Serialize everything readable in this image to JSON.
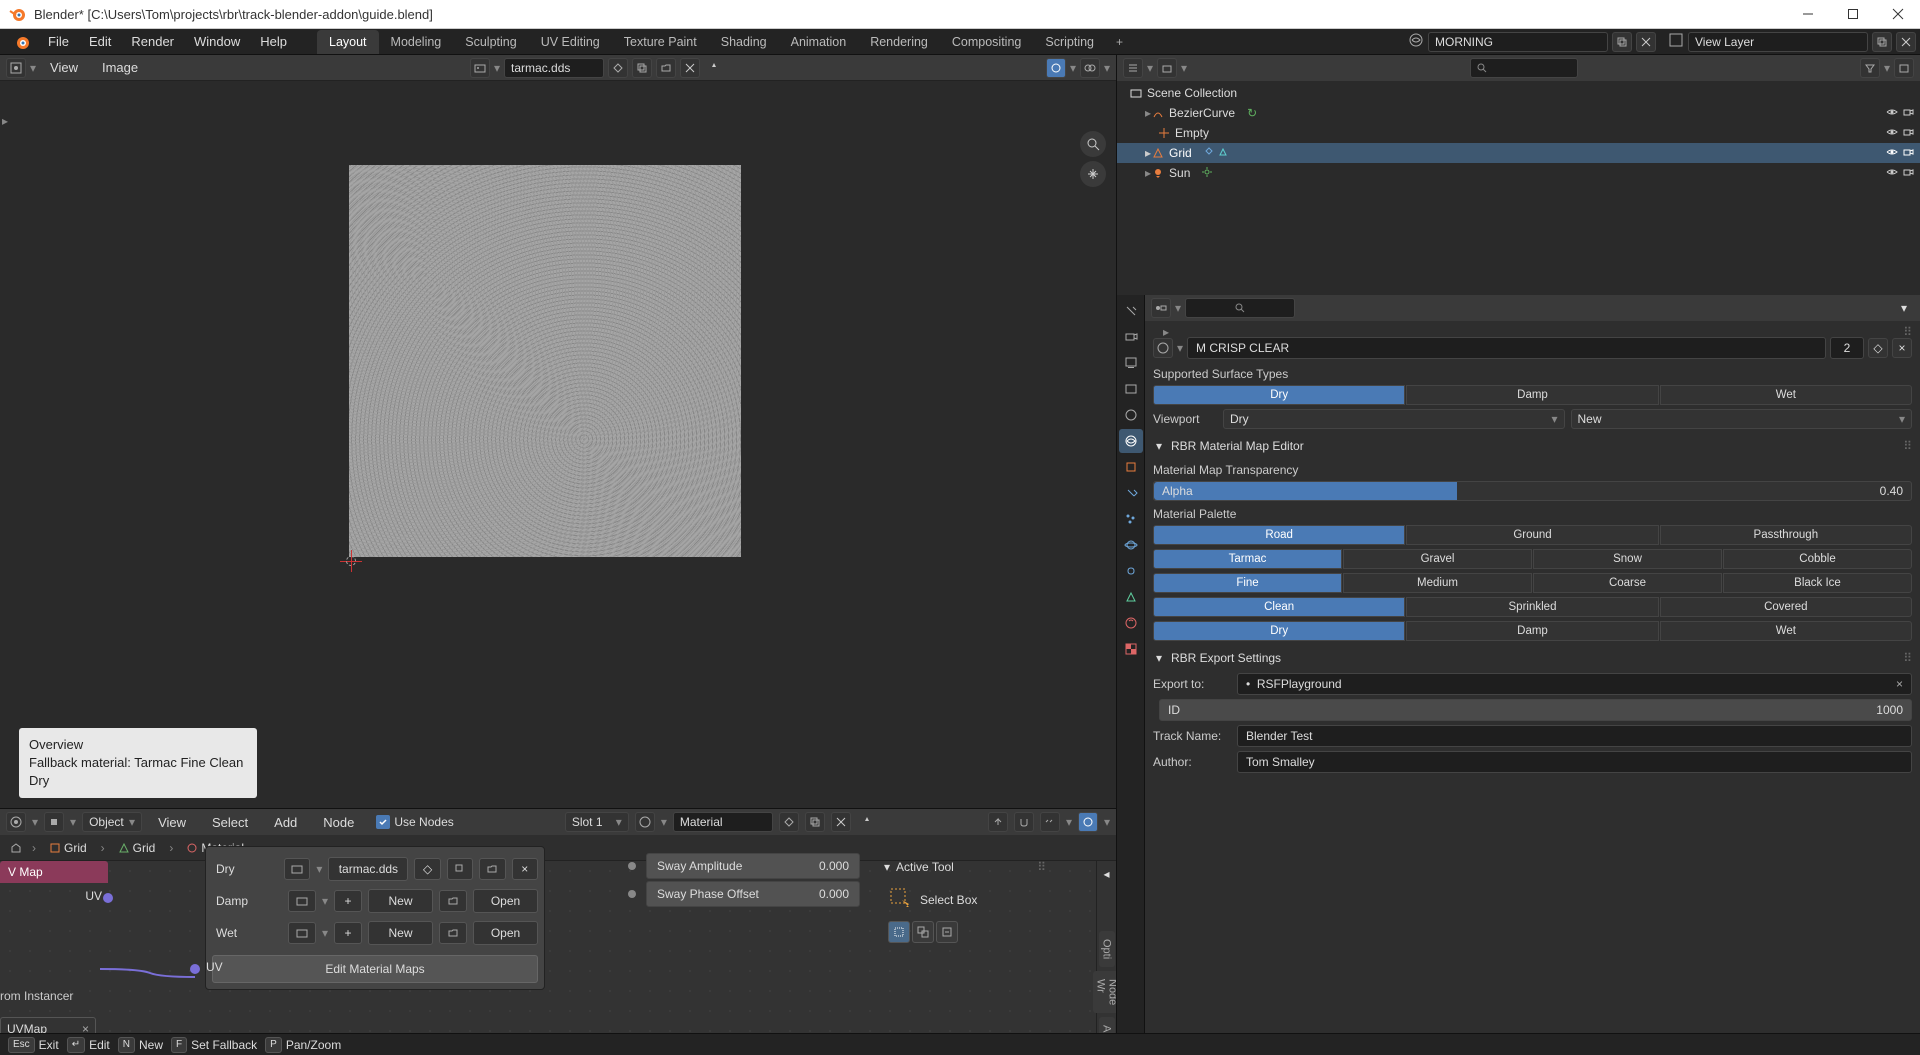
{
  "window": {
    "title": "Blender* [C:\\Users\\Tom\\projects\\rbr\\track-blender-addon\\guide.blend]"
  },
  "menubar": {
    "items": [
      "File",
      "Edit",
      "Render",
      "Window",
      "Help"
    ]
  },
  "workspaces": {
    "tabs": [
      "Layout",
      "Modeling",
      "Sculpting",
      "UV Editing",
      "Texture Paint",
      "Shading",
      "Animation",
      "Rendering",
      "Compositing",
      "Scripting"
    ],
    "active": 0
  },
  "scene": {
    "name": "MORNING"
  },
  "viewlayer": {
    "name": "View Layer"
  },
  "image_editor": {
    "menus": [
      "View",
      "Image"
    ],
    "image_name": "tarmac.dds"
  },
  "overview": {
    "title": "Overview",
    "line": "Fallback material: Tarmac Fine Clean Dry"
  },
  "outliner": {
    "root": "Scene Collection",
    "items": [
      {
        "name": "BezierCurve",
        "type": "curve"
      },
      {
        "name": "Empty",
        "type": "empty"
      },
      {
        "name": "Grid",
        "type": "mesh",
        "selected": true
      },
      {
        "name": "Sun",
        "type": "light"
      }
    ]
  },
  "node_editor": {
    "menus": [
      "View",
      "Select",
      "Add",
      "Node"
    ],
    "use_nodes_label": "Use Nodes",
    "object_mode": "Object",
    "slot": "Slot 1",
    "material": "Material",
    "breadcrumb": [
      "Grid",
      "Grid",
      "Material"
    ],
    "maps": {
      "dry": {
        "label": "Dry",
        "image": "tarmac.dds"
      },
      "damp": {
        "label": "Damp",
        "new": "New",
        "open": "Open"
      },
      "wet": {
        "label": "Wet",
        "new": "New",
        "open": "Open"
      },
      "edit_btn": "Edit Material Maps"
    },
    "uv_node_title": "V Map",
    "uv_out_label": "UV",
    "uv_in_label": "UV",
    "instancer_label": "rom Instancer",
    "uvmap_chip": "UVMap",
    "sway": {
      "amp": {
        "label": "Sway Amplitude",
        "value": "0.000"
      },
      "phase": {
        "label": "Sway Phase Offset",
        "value": "0.000"
      }
    },
    "active_tool": {
      "title": "Active Tool",
      "tool": "Select Box"
    },
    "vbar_tabs": [
      "Opti",
      "Node Wr",
      "Arra"
    ]
  },
  "props": {
    "world_name": "M CRISP CLEAR",
    "world_users": "2",
    "supported_label": "Supported Surface Types",
    "surfaces": [
      "Dry",
      "Damp",
      "Wet"
    ],
    "viewport_label": "Viewport",
    "viewport_value": "Dry",
    "viewport_new": "New",
    "panel_map_editor": "RBR Material Map Editor",
    "transparency_label": "Material Map Transparency",
    "alpha_label": "Alpha",
    "alpha_value": "0.40",
    "palette_label": "Material Palette",
    "palette_rows": [
      {
        "opts": [
          "Road",
          "Ground",
          "Passthrough"
        ],
        "active": 0
      },
      {
        "opts": [
          "Tarmac",
          "Gravel",
          "Snow",
          "Cobble"
        ],
        "active": 0
      },
      {
        "opts": [
          "Fine",
          "Medium",
          "Coarse",
          "Black Ice"
        ],
        "active": 0
      },
      {
        "opts": [
          "Clean",
          "Sprinkled",
          "Covered"
        ],
        "active": 0
      },
      {
        "opts": [
          "Dry",
          "Damp",
          "Wet"
        ],
        "active": 0
      }
    ],
    "panel_export": "RBR Export Settings",
    "export_to_label": "Export to:",
    "export_to_value": "RSFPlayground",
    "id_label": "ID",
    "id_value": "1000",
    "track_name_label": "Track Name:",
    "track_name_value": "Blender Test",
    "author_label": "Author:",
    "author_value": "Tom Smalley"
  },
  "statusbar": {
    "items": [
      {
        "key": "Esc",
        "label": "Exit"
      },
      {
        "key": "↵",
        "label": "Edit"
      },
      {
        "key": "N",
        "label": "New"
      },
      {
        "key": "F",
        "label": "Set Fallback"
      },
      {
        "key": "P",
        "label": "Pan/Zoom"
      }
    ]
  }
}
